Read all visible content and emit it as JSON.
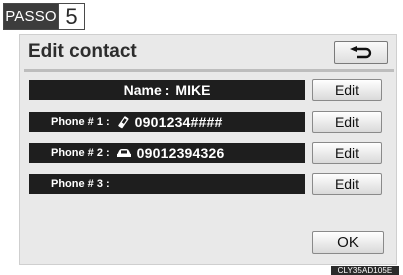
{
  "step": {
    "label": "PASSO",
    "number": "5"
  },
  "screen": {
    "title": "Edit contact",
    "back_icon": "return-arrow-icon",
    "name_row": {
      "label": "Name",
      "separator": ":",
      "value": "MIKE",
      "edit_label": "Edit"
    },
    "phones": [
      {
        "label": "Phone # 1",
        "separator": ":",
        "icon": "mobile-phone-icon",
        "number": "0901234####",
        "edit_label": "Edit"
      },
      {
        "label": "Phone # 2",
        "separator": ":",
        "icon": "car-phone-icon",
        "number": "09012394326",
        "edit_label": "Edit"
      },
      {
        "label": "Phone # 3",
        "separator": ":",
        "icon": "",
        "number": "",
        "edit_label": "Edit"
      }
    ],
    "ok_label": "OK"
  },
  "figure_code": "CLY35AD105E"
}
